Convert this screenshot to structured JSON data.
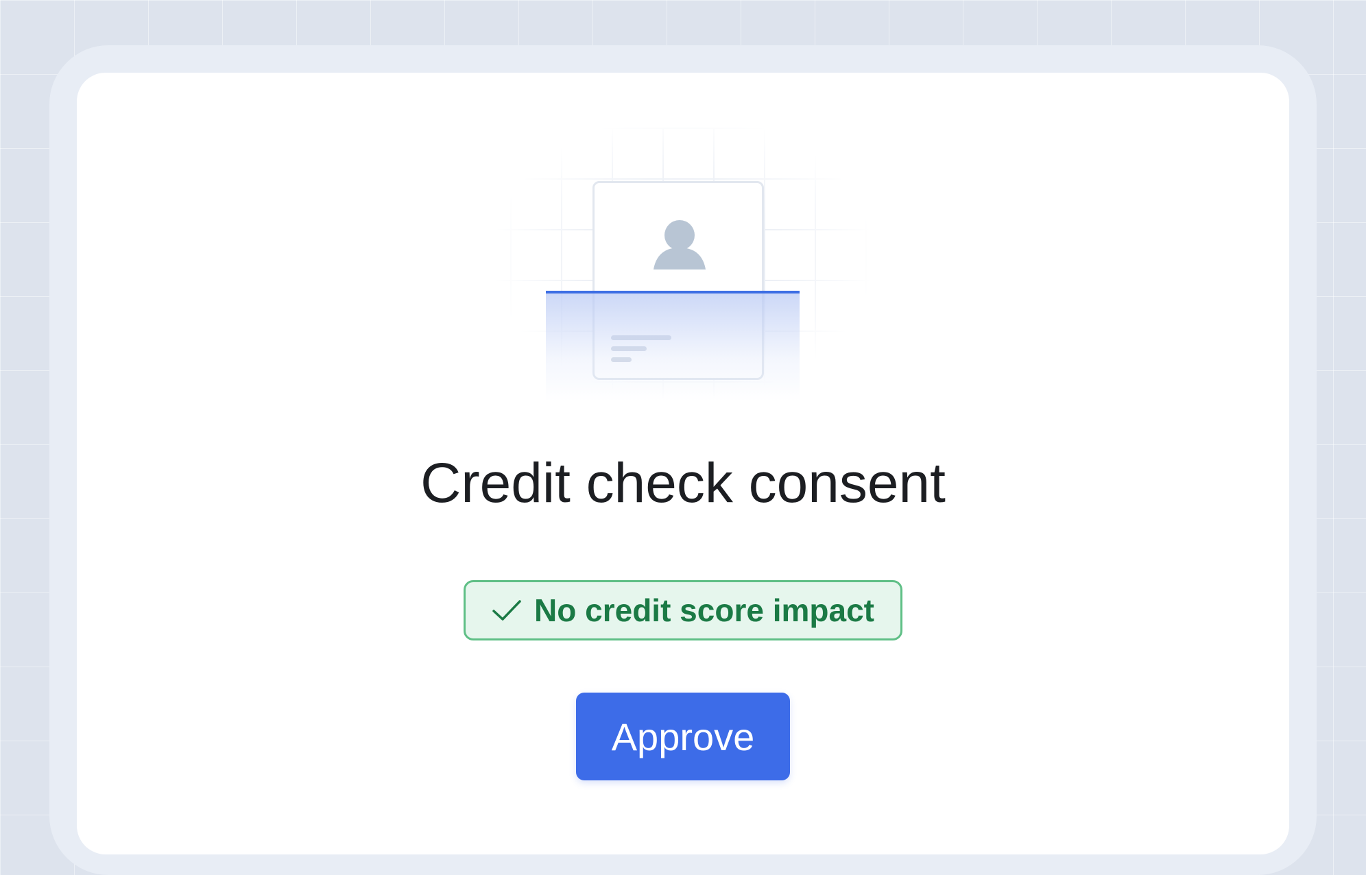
{
  "dialog": {
    "title": "Credit check consent",
    "badge": {
      "label": "No credit score impact",
      "icon": "check-icon",
      "color": "#1b7a45",
      "background": "#e6f6ed",
      "border": "#5fbf86"
    },
    "approve_label": "Approve",
    "accent": "#3d6ce8"
  },
  "illustration": {
    "icons": [
      "id-card-icon",
      "avatar-icon"
    ]
  }
}
